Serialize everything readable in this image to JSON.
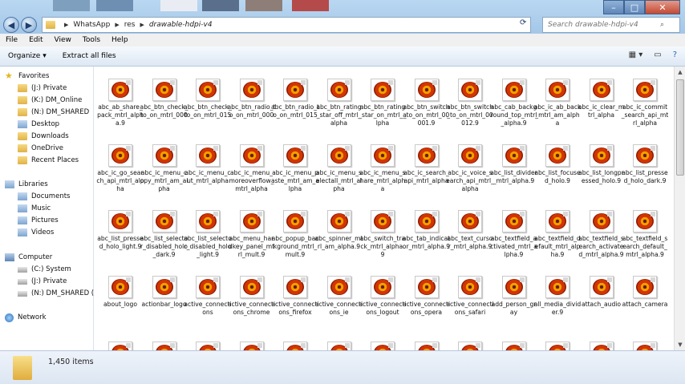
{
  "window": {
    "controls": {
      "minimize": "–",
      "maximize": "□",
      "close": "✕"
    }
  },
  "address": {
    "crumbs": [
      "WhatsApp",
      "res",
      "drawable-hdpi-v4"
    ],
    "search_placeholder": "Search drawable-hdpi-v4"
  },
  "menu": [
    "File",
    "Edit",
    "View",
    "Tools",
    "Help"
  ],
  "toolbar": {
    "organize": "Organize",
    "extract": "Extract all files"
  },
  "nav": {
    "favorites": "Favorites",
    "items": [
      "(J:) Private",
      "(K:) DM_Online",
      "(N:) DM_SHARED",
      "Desktop",
      "Downloads",
      "OneDrive",
      "Recent Places"
    ],
    "libraries": "Libraries",
    "library_items": [
      "Documents",
      "Music",
      "Pictures",
      "Videos"
    ],
    "computer": "Computer",
    "drives": [
      "(C:) System",
      "(J:) Private",
      "(N:) DM_SHARED (\\"
    ],
    "network": "Network"
  },
  "files": [
    "abc_ab_share_pack_mtrl_alpha.9",
    "abc_btn_check_to_on_mtrl_000",
    "abc_btn_check_to_on_mtrl_015",
    "abc_btn_radio_to_on_mtrl_000",
    "abc_btn_radio_to_on_mtrl_015",
    "abc_btn_rating_star_off_mtrl_alpha",
    "abc_btn_rating_star_on_mtrl_alpha",
    "abc_btn_switch_to_on_mtrl_00001.9",
    "abc_btn_switch_to_on_mtrl_00012.9",
    "abc_cab_background_top_mtrl_alpha.9",
    "abc_ic_ab_back_mtrl_am_alpha",
    "abc_ic_clear_mtrl_alpha",
    "abc_ic_commit_search_api_mtrl_alpha",
    "abc_ic_go_search_api_mtrl_alpha",
    "abc_ic_menu_copy_mtrl_am_alpha",
    "abc_ic_menu_cut_mtrl_alpha",
    "abc_ic_menu_moreoverflow_mtrl_alpha",
    "abc_ic_menu_paste_mtrl_am_alpha",
    "abc_ic_menu_selectall_mtrl_alpha",
    "abc_ic_menu_share_mtrl_alpha",
    "abc_ic_search_api_mtrl_alpha",
    "abc_ic_voice_search_api_mtrl_alpha",
    "abc_list_divider_mtrl_alpha.9",
    "abc_list_focused_holo.9",
    "abc_list_longpressed_holo.9",
    "abc_list_pressed_holo_dark.9",
    "abc_list_pressed_holo_light.9",
    "abc_list_selector_disabled_holo_dark.9",
    "abc_list_selector_disabled_holo_light.9",
    "abc_menu_hardkey_panel_mtrl_mult.9",
    "abc_popup_background_mtrl_mult.9",
    "abc_spinner_mtrl_am_alpha.9",
    "abc_switch_track_mtrl_alpha.9",
    "abc_tab_indicator_mtrl_alpha.9",
    "abc_text_cursor_mtrl_alpha.9",
    "abc_textfield_activated_mtrl_alpha.9",
    "abc_textfield_default_mtrl_alpha.9",
    "abc_textfield_search_activated_mtrl_alpha.9",
    "abc_textfield_search_default_mtrl_alpha.9",
    "about_logo",
    "actionbar_logo",
    "active_connections",
    "active_connections_chrome",
    "active_connections_firefox",
    "active_connections_ie",
    "active_connections_logout",
    "active_connections_opera",
    "active_connections_safari",
    "add_person_gray",
    "all_media_divider.9",
    "attach_audio",
    "attach_camera",
    "",
    "",
    "",
    "",
    "",
    "",
    "",
    "",
    "",
    "",
    "",
    "",
    ""
  ],
  "status": {
    "count": "1,450 items"
  }
}
